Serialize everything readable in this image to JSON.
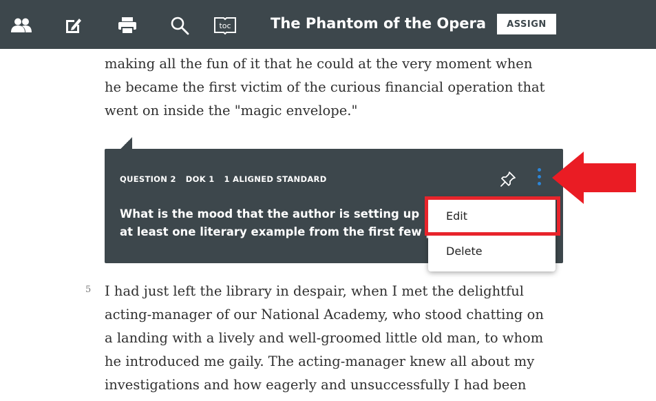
{
  "toolbar": {
    "title": "The Phantom of the Opera",
    "assign_label": "ASSIGN",
    "icons": [
      "people-icon",
      "edit-note-icon",
      "print-icon",
      "search-icon",
      "toc-icon"
    ],
    "toc_text": "toc",
    "background": "#3d474c"
  },
  "reading": {
    "paragraph_1_lines": [
      "making all the fun of it that he could at the very moment when",
      "he became the first victim of the curious financial operation that",
      "went on inside the \"magic envelope.\""
    ],
    "paragraph_5_number": "5",
    "paragraph_5_lines": [
      "I had just left the library in despair, when I met the delightful",
      "acting-manager of our National Academy, who stood chatting on",
      "a landing with a lively and well-groomed little old man, to whom",
      "he introduced me gaily. The acting-manager knew all about my",
      "investigations and how eagerly and unsuccessfully I had been"
    ]
  },
  "question_card": {
    "question_label": "QUESTION 2",
    "dok_label": "DOK 1",
    "standard_label": "1 ALIGNED STANDARD",
    "question_line_1": "What is the mood that the author is setting up",
    "question_line_2": "at least one literary example from the first few p"
  },
  "context_menu": {
    "edit_label": "Edit",
    "delete_label": "Delete"
  },
  "annotation": {
    "highlight_color": "#e8242b",
    "arrow_color": "#ea1c24"
  }
}
